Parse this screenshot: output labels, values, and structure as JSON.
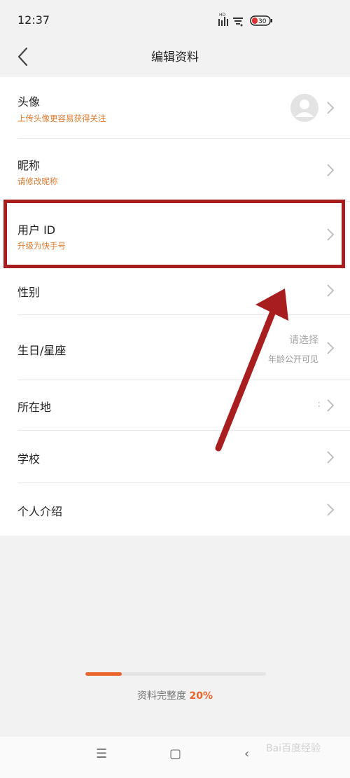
{
  "status_bar": {
    "time": "12:37",
    "signal_badge": "HD",
    "battery_level": "30"
  },
  "header": {
    "title": "编辑资料",
    "back_icon": "chevron-left-icon"
  },
  "profile_rows": [
    {
      "label": "头像",
      "sub": "上传头像更容易获得关注",
      "avatar_icon": "default-avatar-icon"
    },
    {
      "label": "昵称",
      "sub": "请修改昵称"
    },
    {
      "label": "用户 ID",
      "sub": "升级为快手号"
    },
    {
      "label": "性别"
    },
    {
      "label": "生日/星座",
      "value": "请选择",
      "note": "年龄公开可见"
    },
    {
      "label": "所在地",
      "value": ":"
    },
    {
      "label": "学校"
    },
    {
      "label": "个人介绍"
    }
  ],
  "completeness": {
    "label": "资料完整度",
    "percent_text": "20%",
    "fraction": 0.2
  },
  "nav": {
    "menu_icon": "menu-icon",
    "home_icon": "home-square-icon",
    "back_icon": "back-icon"
  },
  "watermark": "Bai百度经验",
  "colors": {
    "accent": "#e8642b",
    "subtext": "#e07a2e",
    "annotation": "#a81d1d",
    "background": "#f2f2f2"
  }
}
